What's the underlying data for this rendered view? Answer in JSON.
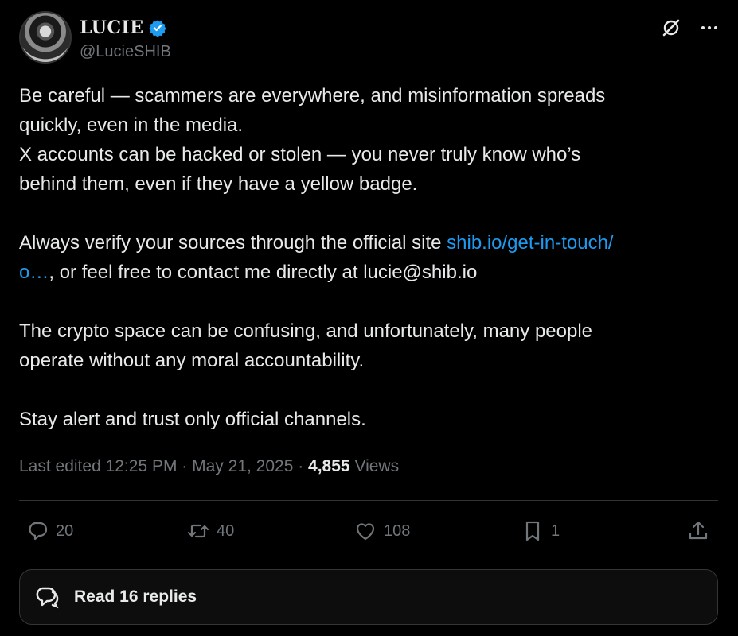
{
  "author": {
    "display_name": "LUCIE",
    "handle": "@LucieSHIB",
    "verified": true
  },
  "icons": {
    "avatar": "avatar-image",
    "verified": "verified-badge-icon",
    "grok": "grok-icon",
    "more": "more-icon",
    "reply": "reply-icon",
    "repost": "repost-icon",
    "like": "heart-icon",
    "bookmark": "bookmark-icon",
    "share": "share-icon",
    "replies": "conversation-icon"
  },
  "post": {
    "line1": "Be careful — scammers are everywhere, and misinformation spreads",
    "line2": "quickly, even in the media.",
    "line3": "X accounts can be hacked or stolen — you never truly know who’s",
    "line4": "behind them, even if they have a yellow badge.",
    "line5_pre": "Always verify your sources through the official site ",
    "link_part1": "shib.io/get-in-touch/",
    "link_part2": "o…",
    "line6_post": ", or feel free to contact me directly at lucie@shib.io",
    "line7": "The crypto space can be confusing, and unfortunately, many people",
    "line8": "operate without any moral accountability.",
    "line9": "Stay alert and trust only official channels."
  },
  "meta": {
    "edited_label": "Last edited 12:25 PM · May 21, 2025 · ",
    "views_count": "4,855",
    "views_label": " Views"
  },
  "stats": {
    "replies": "20",
    "reposts": "40",
    "likes": "108",
    "bookmarks": "1"
  },
  "read_replies": {
    "label": "Read 16 replies"
  },
  "colors": {
    "background": "#000000",
    "text": "#e7e9ea",
    "muted": "#71767b",
    "link": "#1d9bf0",
    "verified": "#1d9bf0"
  }
}
